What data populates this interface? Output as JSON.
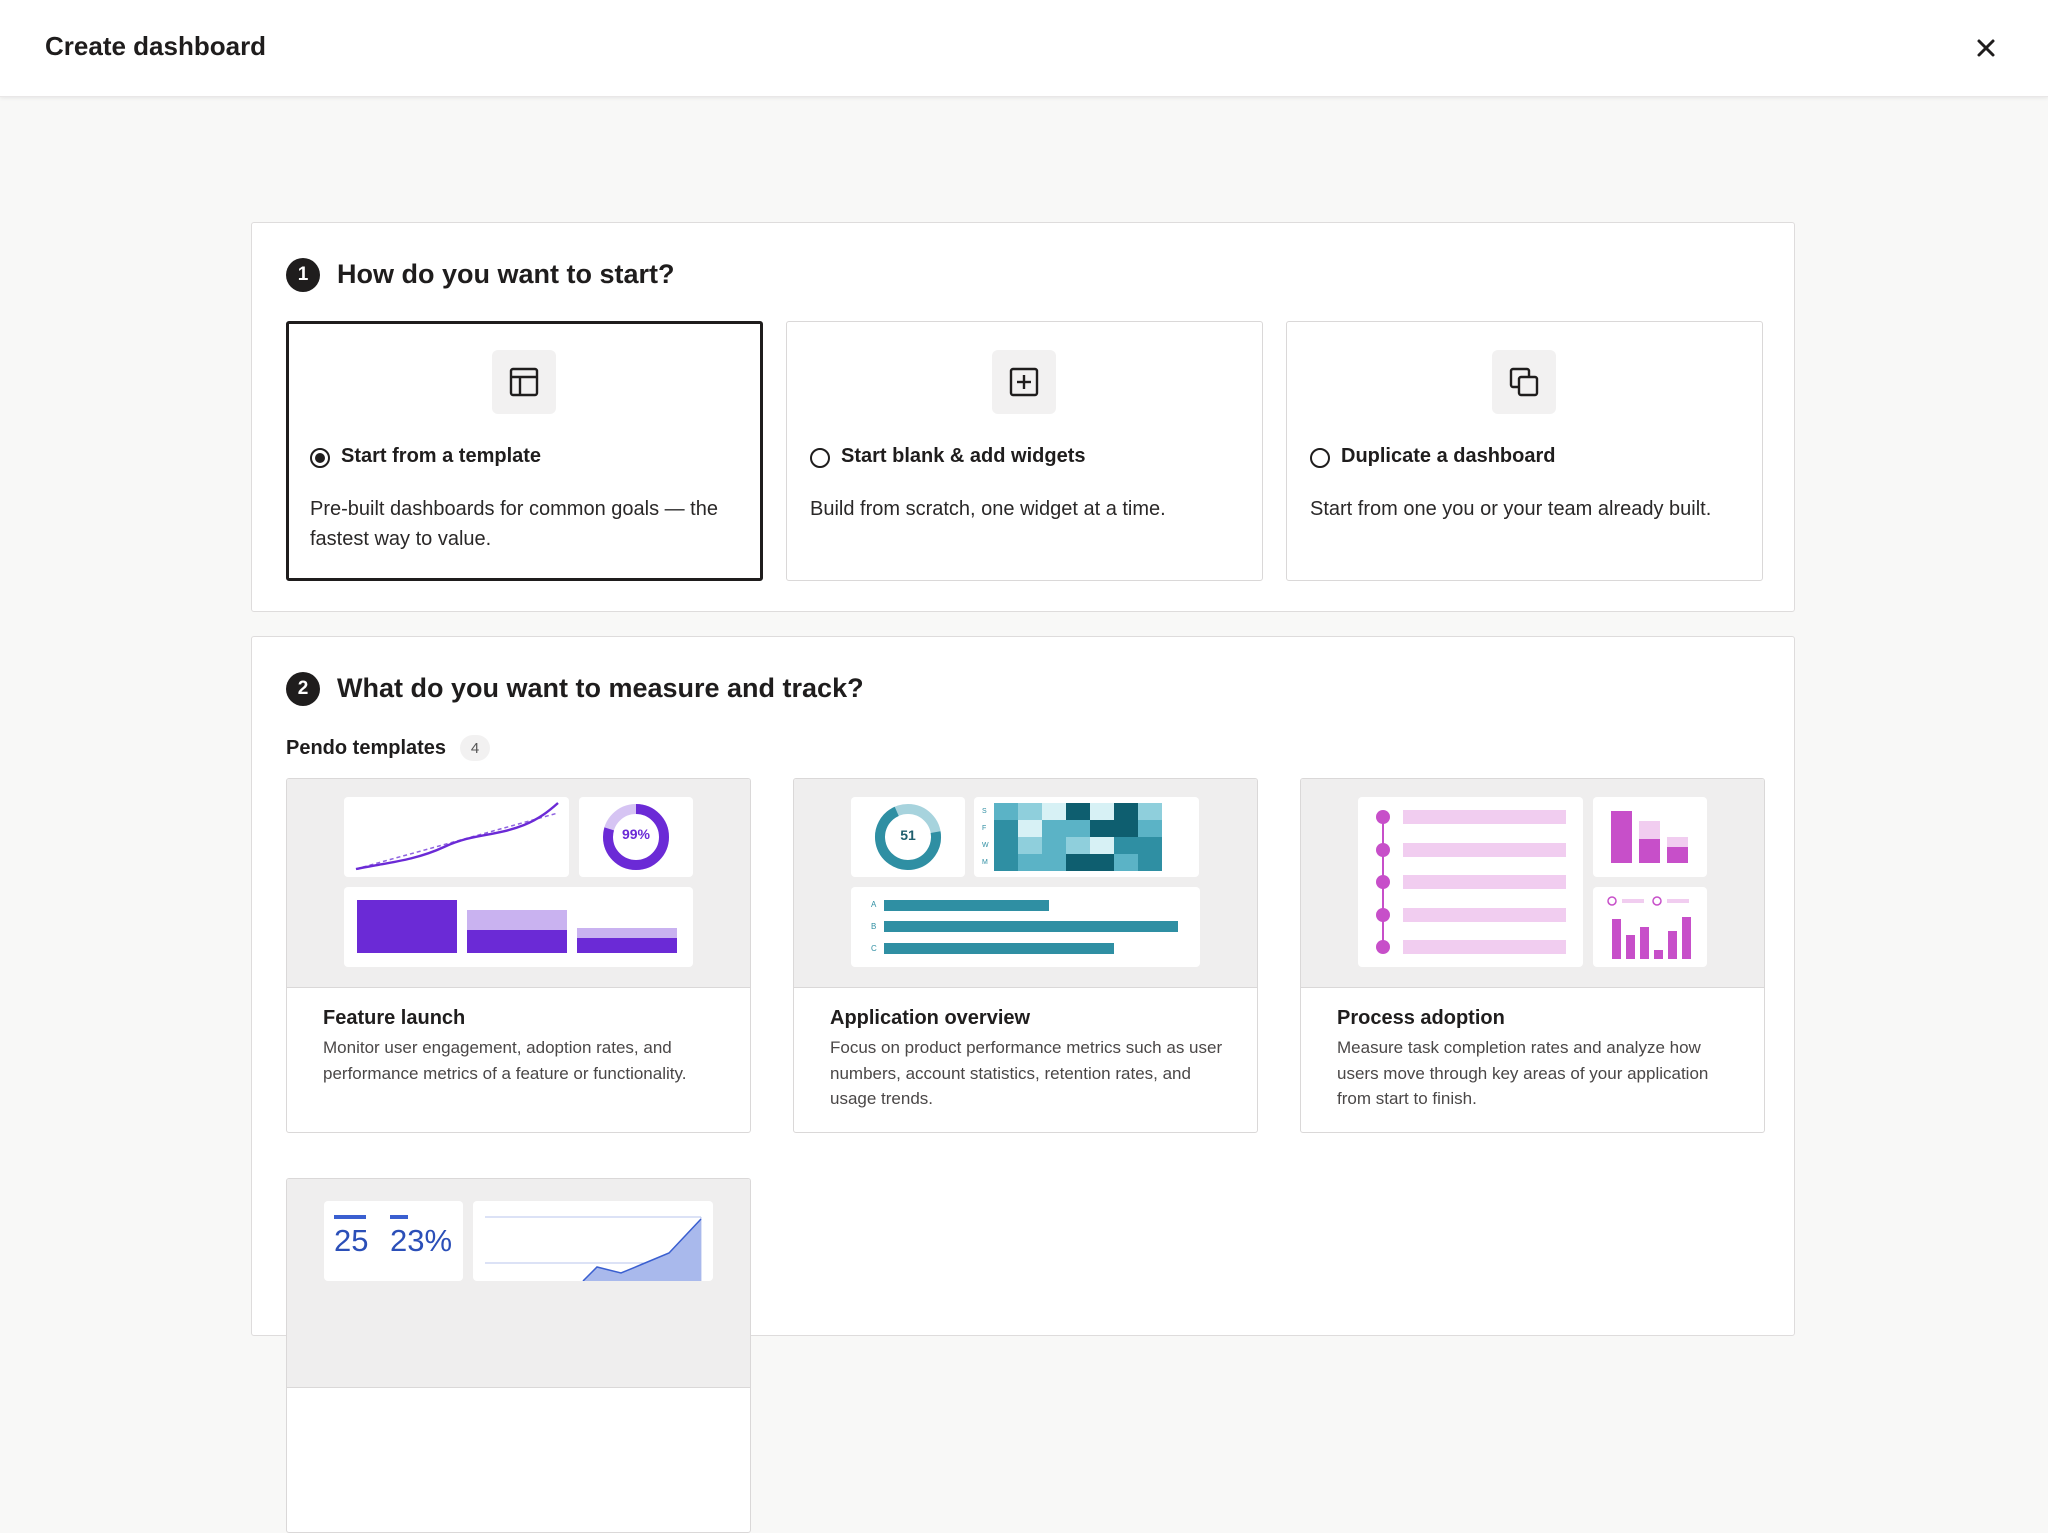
{
  "header": {
    "title": "Create dashboard",
    "close_icon": "close-icon"
  },
  "step1": {
    "number": "1",
    "title": "How do you want to start?",
    "options": [
      {
        "label": "Start from a template",
        "description": "Pre-built dashboards for common goals — the fastest way to value.",
        "icon": "template-layout-icon",
        "selected": true
      },
      {
        "label": "Start blank & add widgets",
        "description": "Build from scratch, one widget at a time.",
        "icon": "plus-square-icon",
        "selected": false
      },
      {
        "label": "Duplicate a dashboard",
        "description": "Start from one you or your team already built.",
        "icon": "copy-icon",
        "selected": false
      }
    ]
  },
  "step2": {
    "number": "2",
    "title": "What do you want to measure and track?",
    "templates_heading": "Pendo templates",
    "templates_count": "4",
    "templates": [
      {
        "name": "Feature launch",
        "description": "Monitor user engagement, adoption rates, and performance metrics of a feature or functionality.",
        "thumb_text": "99%"
      },
      {
        "name": "Application overview",
        "description": "Focus on product performance metrics such as user numbers, account statistics, retention rates, and usage trends.",
        "thumb_text": "51",
        "heatmap_rows": [
          "S",
          "F",
          "W",
          "M"
        ],
        "bar_labels": [
          "A",
          "B",
          "C"
        ]
      },
      {
        "name": "Process adoption",
        "description": "Measure task completion rates and analyze how users move through key areas of your application from start to finish."
      },
      {
        "name": "",
        "description": "",
        "thumb_stats": [
          "25",
          "23%"
        ]
      }
    ]
  },
  "colors": {
    "dark": "#1f1d1d",
    "purple": "#6b2ad6",
    "purple_light": "#c9b2f0",
    "teal": "#2f8fa3",
    "magenta": "#c74fc9",
    "magenta_light": "#f1cdf0",
    "blue": "#3a5fd0"
  }
}
